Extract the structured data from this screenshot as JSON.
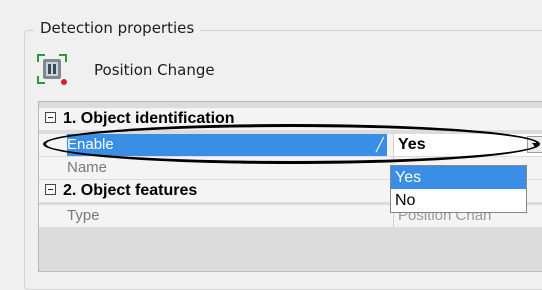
{
  "panel": {
    "title": "Detection properties"
  },
  "detector": {
    "icon": "position-change-icon",
    "name": "Position Change"
  },
  "grid": {
    "category1": {
      "label": "1. Object identification"
    },
    "enable": {
      "name": "Enable",
      "value": "Yes"
    },
    "name_row": {
      "name": "Name",
      "value": ""
    },
    "category2": {
      "label": "2. Object features"
    },
    "type_row": {
      "name": "Type",
      "value": "Position Chan"
    }
  },
  "dropdown": {
    "options": [
      {
        "label": "Yes",
        "highlighted": true
      },
      {
        "label": "No",
        "highlighted": false
      }
    ]
  },
  "colors": {
    "selection": "#3a8ee6",
    "annotation": "#000000"
  }
}
